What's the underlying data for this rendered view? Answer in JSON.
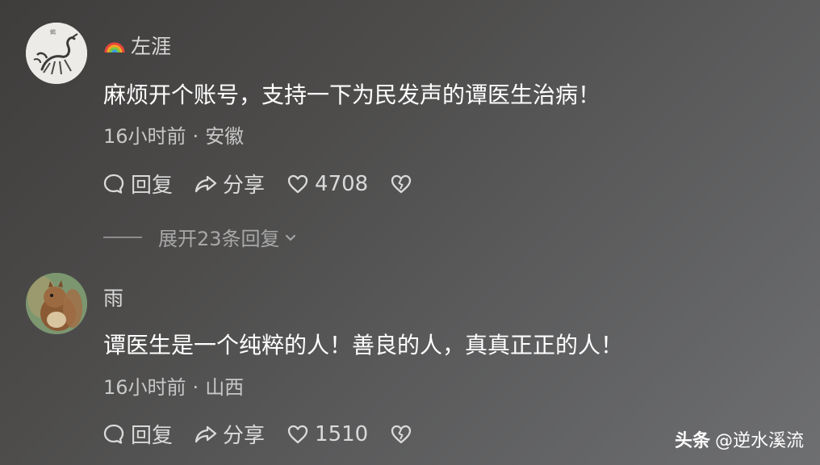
{
  "comments": [
    {
      "username": "左涯",
      "text": "麻烦开个账号，支持一下为民发声的谭医生治病！",
      "time": "16小时前",
      "location": "安徽",
      "reply_label": "回复",
      "share_label": "分享",
      "likes": "4708",
      "expand_label": "展开23条回复"
    },
    {
      "username": "雨",
      "text": "谭医生是一个纯粹的人！善良的人，真真正正的人！",
      "time": "16小时前",
      "location": "山西",
      "reply_label": "回复",
      "share_label": "分享",
      "likes": "1510"
    }
  ],
  "separator": "·",
  "watermark": {
    "brand": "头条",
    "handle": "@逆水溪流"
  },
  "icons": [
    "rainbow-icon",
    "comment-icon",
    "share-icon",
    "heart-icon",
    "broken-heart-icon",
    "chevron-down-icon"
  ],
  "colors": {
    "background": "#4d4c4b",
    "text": "#ffffff",
    "meta": "#c8c8c8"
  }
}
